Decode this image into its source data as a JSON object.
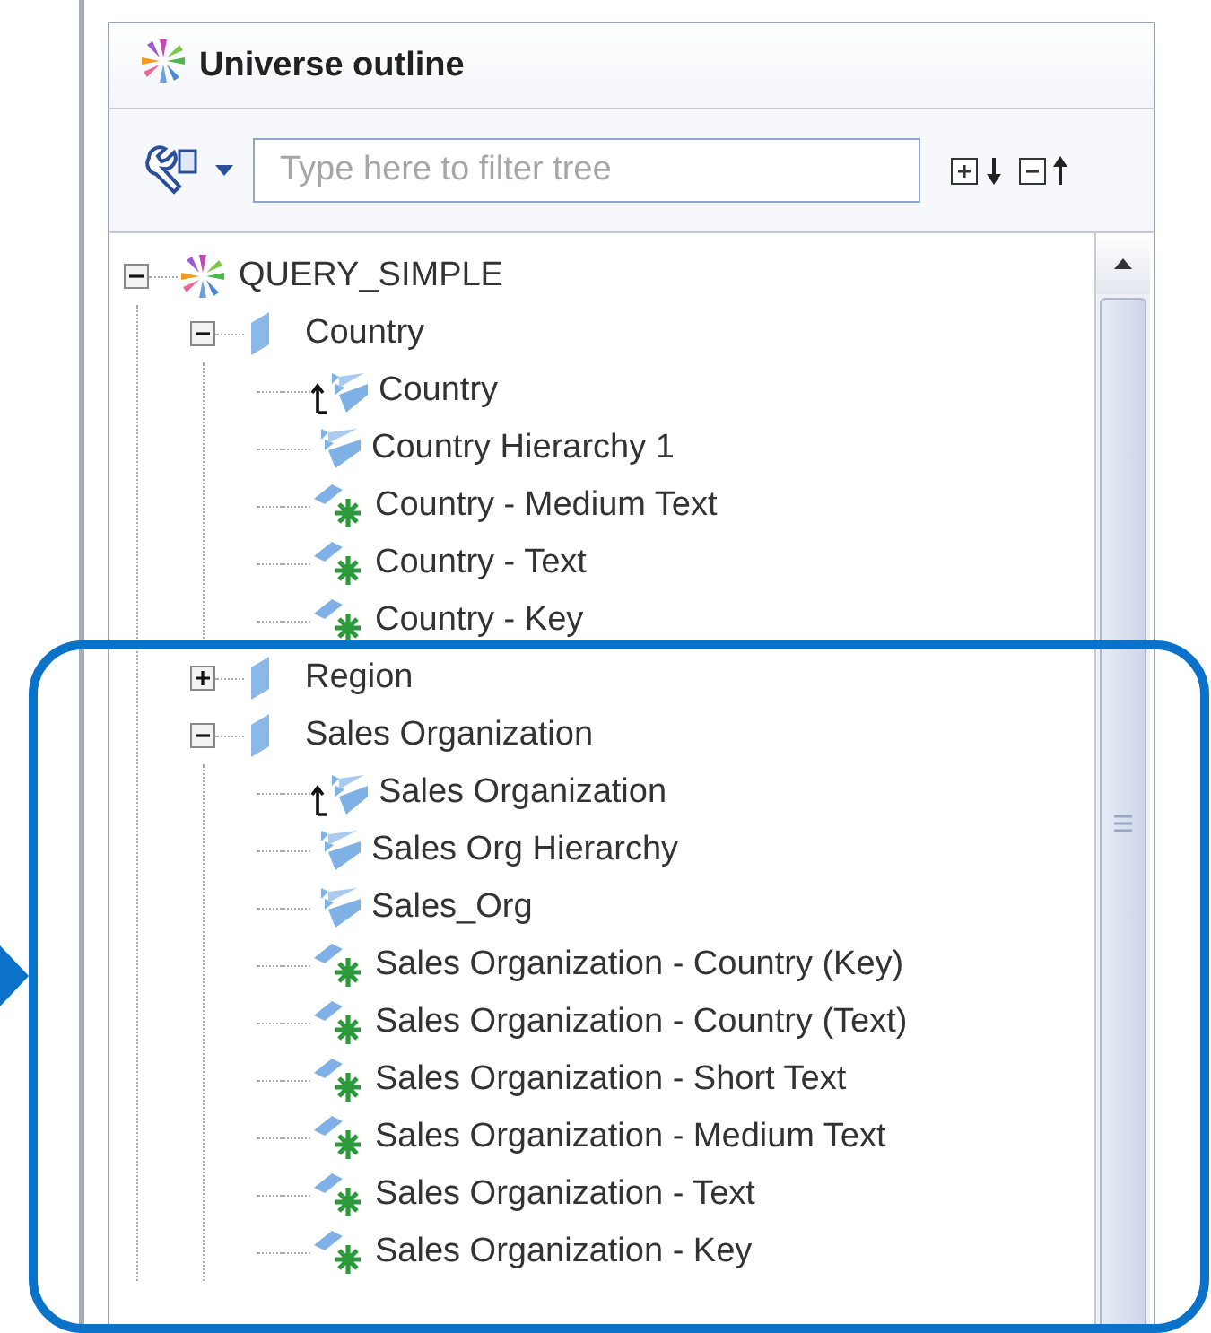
{
  "panel": {
    "title": "Universe outline"
  },
  "toolbar": {
    "filter": {
      "placeholder": "Type here to filter tree"
    }
  },
  "tree": [
    {
      "kind": "universe",
      "label": "QUERY_SIMPLE",
      "expanded": true,
      "children": [
        {
          "kind": "folder",
          "label": "Country",
          "expanded": true,
          "children": [
            {
              "kind": "default-hierarchy",
              "label": "Country"
            },
            {
              "kind": "hierarchy",
              "label": "Country Hierarchy 1"
            },
            {
              "kind": "attribute",
              "label": "Country - Medium Text"
            },
            {
              "kind": "attribute",
              "label": "Country - Text"
            },
            {
              "kind": "attribute",
              "label": "Country - Key"
            }
          ]
        },
        {
          "kind": "folder",
          "label": "Region",
          "expanded": false
        },
        {
          "kind": "folder",
          "label": "Sales Organization",
          "expanded": true,
          "children": [
            {
              "kind": "default-hierarchy",
              "label": "Sales Organization"
            },
            {
              "kind": "hierarchy",
              "label": "Sales Org Hierarchy"
            },
            {
              "kind": "hierarchy",
              "label": "Sales_Org"
            },
            {
              "kind": "attribute",
              "label": "Sales Organization - Country (Key)"
            },
            {
              "kind": "attribute",
              "label": "Sales Organization - Country (Text)"
            },
            {
              "kind": "attribute",
              "label": "Sales Organization - Short Text"
            },
            {
              "kind": "attribute",
              "label": "Sales Organization - Medium Text"
            },
            {
              "kind": "attribute",
              "label": "Sales Organization - Text"
            },
            {
              "kind": "attribute",
              "label": "Sales Organization - Key"
            }
          ]
        }
      ]
    }
  ]
}
